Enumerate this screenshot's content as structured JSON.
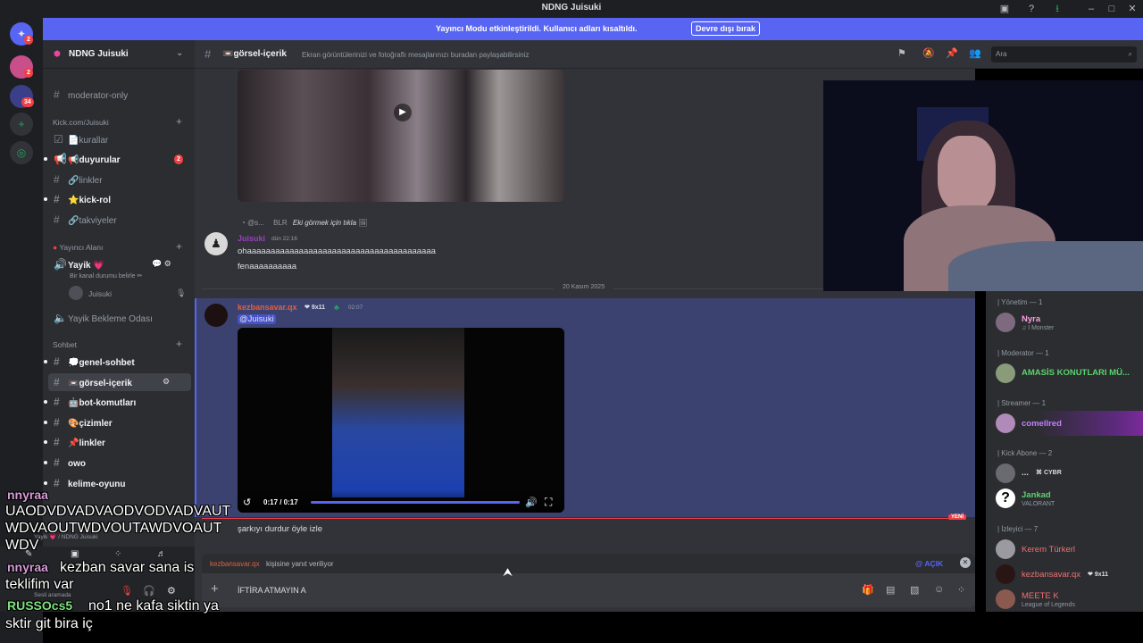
{
  "titlebar": {
    "title": "NDNG Juisuki"
  },
  "rail": {
    "badges": [
      "2",
      "2",
      "34"
    ]
  },
  "banner": {
    "text": "Yayıncı Modu etkinleştirildi. Kullanıcı adları kısaltıldı.",
    "button": "Devre dışı bırak"
  },
  "server": {
    "name": "NDNG Juisuki"
  },
  "sidebar": {
    "top_channel": "moderator-only",
    "categories": [
      "Kick.com/Juisuki",
      "Yayıncı Alanı",
      "Sohbet"
    ],
    "kick_channels": [
      {
        "label": "📄kurallar"
      },
      {
        "label": "📢duyurular",
        "badge": "2"
      },
      {
        "label": "🔗linkler"
      },
      {
        "label": "⭐kick-rol"
      },
      {
        "label": "🔗takviyeler"
      }
    ],
    "voice": {
      "name": "Yayik 💗",
      "status": "Bir kanal durumu belirle ✏",
      "user": "Juisuki",
      "waiting": "Yayik Bekleme Odası"
    },
    "sohbet_channels": [
      {
        "label": "💭genel-sohbet"
      },
      {
        "label": "📼görsel-içerik"
      },
      {
        "label": "🤖bot-komutları"
      },
      {
        "label": "🎨çizimler"
      },
      {
        "label": "📌linkler"
      },
      {
        "label": "owo"
      },
      {
        "label": "kelime-oyunu"
      }
    ]
  },
  "chat": {
    "channel": "📼görsel-içerik",
    "topic": "Ekran görüntülerinizi ve fotoğraflı mesajlarınızı buradan paylaşabilirsiniz",
    "search_placeholder": "Ara",
    "reply_preview": {
      "author": "@s...",
      "tag": "BLR",
      "text": "Eki görmek için tıkla"
    },
    "msg1": {
      "author": "Juisuki",
      "time": "dün 22:16",
      "lines": [
        "ohaaaaaaaaaaaaaaaaaaaaaaaaaaaaaaaaaaaaaaaa",
        "fenaaaaaaaaaa"
      ]
    },
    "date_divider": "20 Kasım 2025",
    "msg2": {
      "author": "kezbansavar.qx",
      "tag": "9x11",
      "time": "02:07",
      "mention": "@Juisuki",
      "video_time": "0:17 / 0:17"
    },
    "new_label": "YENİ",
    "msg3_text": "şarkıyı durdur öyle izle",
    "replying": {
      "user": "kezbansavar.qx",
      "suffix": "kişisine yanıt veriliyor",
      "mention_toggle": "@ AÇIK"
    },
    "composer_text": "İFTİRA ATMAYIN A"
  },
  "members": {
    "groups": [
      {
        "category": "| Yönetim — 1",
        "name": "Nyra",
        "sub": "♫ I Monster",
        "color": "#ff9ee0"
      },
      {
        "category": "| Moderator — 1",
        "name": "AMASİS KONUTLARI MÜ...",
        "sub": "",
        "color": "#5bd36b"
      },
      {
        "category": "| Streamer — 1",
        "name": "comellred",
        "sub": "",
        "color": "#c77dff"
      },
      {
        "category": "| Kick Abone — 2",
        "name": "...",
        "tag": "CYBR",
        "sub": "",
        "color": "#dbdee1"
      },
      {
        "category": "",
        "name": "Jankad",
        "sub": "VALORANT",
        "color": "#5bd36b"
      },
      {
        "category": "| İzleyici — 7",
        "name": "Kerem Türkerl",
        "sub": "",
        "color": "#f07070"
      },
      {
        "category": "",
        "name": "kezbansavar.qx",
        "tag": "9x11",
        "sub": "",
        "color": "#f07070"
      },
      {
        "category": "",
        "name": "MEETE K",
        "sub": "League of Legends",
        "color": "#f07070"
      }
    ]
  },
  "userpanel": {
    "path": "Yayik 💗 / NDNG Juisuki",
    "voice_status": "Sesli aramada"
  },
  "overlay_chat": [
    {
      "user": "nnyraa",
      "text": ""
    },
    {
      "user": "",
      "text": "UAODVDVADVAODVODVADVAUT"
    },
    {
      "user": "",
      "text": "WDVAOUTWDVOUTAWDVOAUT"
    },
    {
      "user": "",
      "text": "WDV"
    },
    {
      "user": "nnyraa",
      "text": "kezban savar sana is"
    },
    {
      "user": "",
      "text": "teklifim var"
    },
    {
      "user": "RUSSOcs5",
      "text": "no1 ne kafa siktin ya"
    },
    {
      "user": "",
      "text": "sktir git bira iç"
    }
  ],
  "colors": {
    "accent": "#5865f2",
    "mention_bg": "#3c4270",
    "red": "#f23f43"
  }
}
